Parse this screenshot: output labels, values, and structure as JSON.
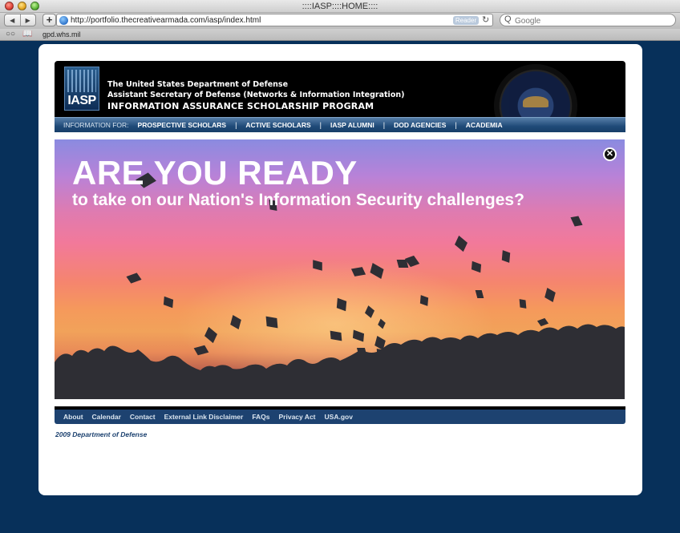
{
  "browser": {
    "window_title": "::::IASP::::HOME::::",
    "back_glyph": "◀",
    "forward_glyph": "▶",
    "add_glyph": "+",
    "url": "http://portfolio.thecreativearmada.com/iasp/index.html",
    "reader_label": "Reader",
    "reload_glyph": "↻",
    "search_placeholder": "Google",
    "search_glyph": "Q",
    "bookmark_glyph_glasses": "○○",
    "bookmark_glyph_book": "📖",
    "bookmark_link": "gpd.whs.mil"
  },
  "header": {
    "logo_text": "IASP",
    "line1": "The United States Department of Defense",
    "line2": "Assistant Secretary of Defense (Networks & Information Integration)",
    "line3": "INFORMATION ASSURANCE SCHOLARSHIP PROGRAM"
  },
  "nav": {
    "label": "INFORMATION FOR:",
    "items": [
      "PROSPECTIVE SCHOLARS",
      "ACTIVE SCHOLARS",
      "IASP ALUMNI",
      "DOD AGENCIES",
      "ACADEMIA"
    ],
    "separator": "|"
  },
  "hero": {
    "title": "ARE YOU READY",
    "subtitle": "to take on our Nation's Information Security challenges?",
    "close_glyph": "✕"
  },
  "footer": {
    "links": [
      "About",
      "Calendar",
      "Contact",
      "External Link Disclaimer",
      "FAQs",
      "Privacy Act",
      "USA.gov"
    ],
    "copyright": "2009 Department of Defense"
  },
  "colors": {
    "page_background": "#07305a",
    "nav_blue": "#1f4a78",
    "footer_blue": "#1d4270",
    "cap_silhouette": "#2e2e34"
  }
}
